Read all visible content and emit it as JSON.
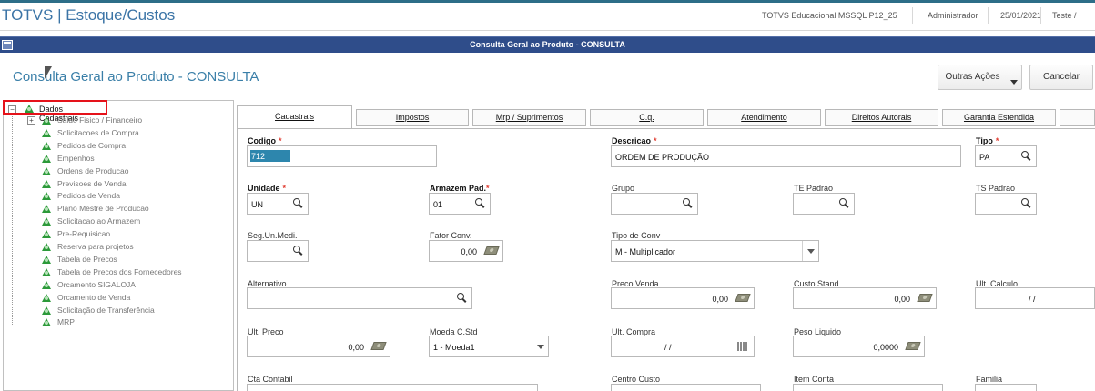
{
  "app": {
    "title": "TOTVS | Estoque/Custos",
    "environment": "TOTVS Educacional MSSQL P12_25",
    "user": "Administrador",
    "date": "25/01/2021",
    "company": "Teste /"
  },
  "window": {
    "title": "Consulta Geral ao Produto - CONSULTA"
  },
  "page": {
    "title": "Consulta Geral ao Produto - CONSULTA",
    "actions_label": "Outras Ações",
    "cancel_label": "Cancelar"
  },
  "tree": {
    "root": "Dados Cadastrais",
    "items": [
      "Saldo Fisico / Financeiro",
      "Solicitacoes de Compra",
      "Pedidos de Compra",
      "Empenhos",
      "Ordens de Producao",
      "Previsoes de Venda",
      "Pedidos de Venda",
      "Plano Mestre de Producao",
      "Solicitacao ao Armazem",
      "Pre-Requisicao",
      "Reserva para projetos",
      "Tabela de Precos",
      "Tabela de Precos dos Fornecedores",
      "Orcamento SIGALOJA",
      "Orcamento de Venda",
      "Solicitação de Transferência",
      "MRP"
    ]
  },
  "tabs": [
    "Cadastrais",
    "Impostos",
    "Mrp / Suprimentos",
    "C.q.",
    "Atendimento",
    "Direitos Autorais",
    "Garantia Estendida"
  ],
  "form": {
    "codigo": {
      "label": "Codigo",
      "value": "712"
    },
    "descricao": {
      "label": "Descricao",
      "value": "ORDEM DE PRODUÇÃO"
    },
    "tipo": {
      "label": "Tipo",
      "value": "PA"
    },
    "unidade": {
      "label": "Unidade",
      "value": "UN"
    },
    "armazem": {
      "label": "Armazem Pad.",
      "value": "01"
    },
    "grupo": {
      "label": "Grupo",
      "value": ""
    },
    "te_padrao": {
      "label": "TE Padrao",
      "value": ""
    },
    "ts_padrao": {
      "label": "TS Padrao",
      "value": ""
    },
    "seg_un": {
      "label": "Seg.Un.Medi.",
      "value": ""
    },
    "fator_conv": {
      "label": "Fator Conv.",
      "value": "0,00"
    },
    "tipo_conv": {
      "label": "Tipo de Conv",
      "value": "M - Multiplicador"
    },
    "alternativo": {
      "label": "Alternativo",
      "value": ""
    },
    "preco_venda": {
      "label": "Preco Venda",
      "value": "0,00"
    },
    "custo_stand": {
      "label": "Custo Stand.",
      "value": "0,00"
    },
    "ult_calculo": {
      "label": "Ult. Calculo",
      "value": "/ /"
    },
    "ult_preco": {
      "label": "Ult. Preco",
      "value": "0,00"
    },
    "moeda": {
      "label": "Moeda C.Std",
      "value": "1 - Moeda1"
    },
    "ult_compra": {
      "label": "Ult. Compra",
      "value": "/ /"
    },
    "peso_liquido": {
      "label": "Peso Liquido",
      "value": "0,0000"
    },
    "cta_contabil": {
      "label": "Cta Contabil"
    },
    "centro_custo": {
      "label": "Centro Custo"
    },
    "item_conta": {
      "label": "Item Conta"
    },
    "familia": {
      "label": "Familia"
    },
    "required_mark": "*"
  }
}
